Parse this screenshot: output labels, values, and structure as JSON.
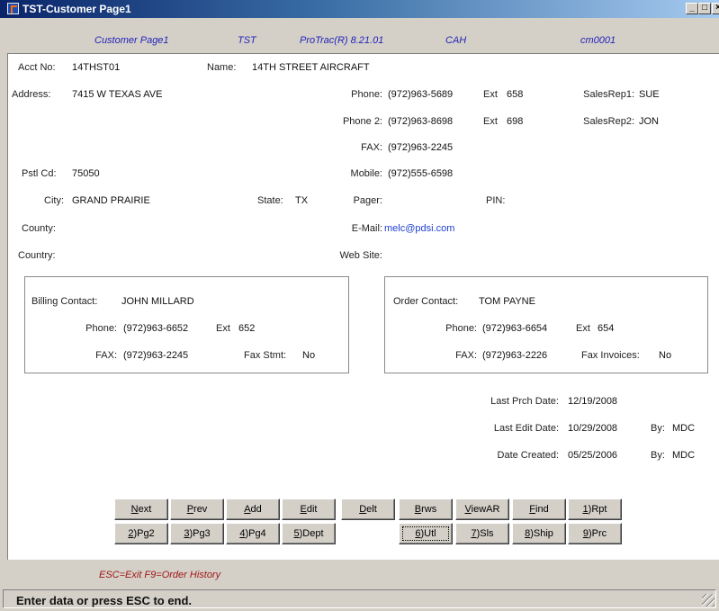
{
  "window": {
    "title": "TST-Customer Page1"
  },
  "header": {
    "page": "Customer Page1",
    "company": "TST",
    "product": "ProTrac(R) 8.21.01",
    "user": "CAH",
    "screen_id": "cm0001"
  },
  "customer": {
    "acct_label": "Acct No:",
    "acct": "14THST01",
    "name_label": "Name:",
    "name": "14TH STREET AIRCRAFT",
    "address_label": "Address:",
    "address": "7415 W TEXAS AVE",
    "postal_label": "Pstl Cd:",
    "postal": "75050",
    "city_label": "City:",
    "city": "GRAND PRAIRIE",
    "state_label": "State:",
    "state": "TX",
    "county_label": "County:",
    "country_label": "Country:"
  },
  "contact": {
    "phone_label": "Phone:",
    "phone": "(972)963-5689",
    "ext_label": "Ext",
    "ext": "658",
    "phone2_label": "Phone 2:",
    "phone2": "(972)963-8698",
    "ext2_label": "Ext",
    "ext2": "698",
    "fax_label": "FAX:",
    "fax": "(972)963-2245",
    "mobile_label": "Mobile:",
    "mobile": "(972)555-6598",
    "pager_label": "Pager:",
    "pin_label": "PIN:",
    "email_label": "E-Mail:",
    "email": "melc@pdsi.com",
    "web_label": "Web Site:",
    "salesrep1_label": "SalesRep1:",
    "salesrep1": "SUE",
    "salesrep2_label": "SalesRep2:",
    "salesrep2": "JON"
  },
  "billing": {
    "label": "Billing Contact:",
    "name": "JOHN MILLARD",
    "phone_label": "Phone:",
    "phone": "(972)963-6652",
    "ext_label": "Ext",
    "ext": "652",
    "fax_label": "FAX:",
    "fax": "(972)963-2245",
    "faxstmt_label": "Fax Stmt:",
    "faxstmt": "No"
  },
  "order": {
    "label": "Order Contact:",
    "name": "TOM PAYNE",
    "phone_label": "Phone:",
    "phone": "(972)963-6654",
    "ext_label": "Ext",
    "ext": "654",
    "fax_label": "FAX:",
    "fax": "(972)963-2226",
    "faxinv_label": "Fax Invoices:",
    "faxinv": "No"
  },
  "dates": {
    "last_prch_label": "Last Prch Date:",
    "last_prch": "12/19/2008",
    "last_edit_label": "Last Edit Date:",
    "last_edit": "10/29/2008",
    "edit_by_label": "By:",
    "edit_by": "MDC",
    "created_label": "Date Created:",
    "created": "05/25/2006",
    "created_by_label": "By:",
    "created_by": "MDC"
  },
  "buttons_row1": [
    {
      "key": "N",
      "rest": "ext"
    },
    {
      "key": "P",
      "rest": "rev"
    },
    {
      "key": "A",
      "rest": "dd"
    },
    {
      "key": "E",
      "rest": "dit"
    },
    {
      "key": "D",
      "rest": "elt"
    },
    {
      "key": "B",
      "rest": "rws"
    },
    {
      "key": "V",
      "rest": "iewAR"
    },
    {
      "key": "F",
      "rest": "ind"
    },
    {
      "key": "1",
      "rest": ")Rpt"
    }
  ],
  "buttons_row2": [
    {
      "key": "2",
      "rest": ")Pg2"
    },
    {
      "key": "3",
      "rest": ")Pg3"
    },
    {
      "key": "4",
      "rest": ")Pg4"
    },
    {
      "key": "5",
      "rest": ")Dept"
    },
    {
      "key": "6",
      "rest": ")Utl"
    },
    {
      "key": "7",
      "rest": ")Sls"
    },
    {
      "key": "8",
      "rest": ")Ship"
    },
    {
      "key": "9",
      "rest": ")Prc"
    }
  ],
  "footer": {
    "hint": "ESC=Exit  F9=Order History",
    "status": "Enter data or press ESC to end."
  }
}
